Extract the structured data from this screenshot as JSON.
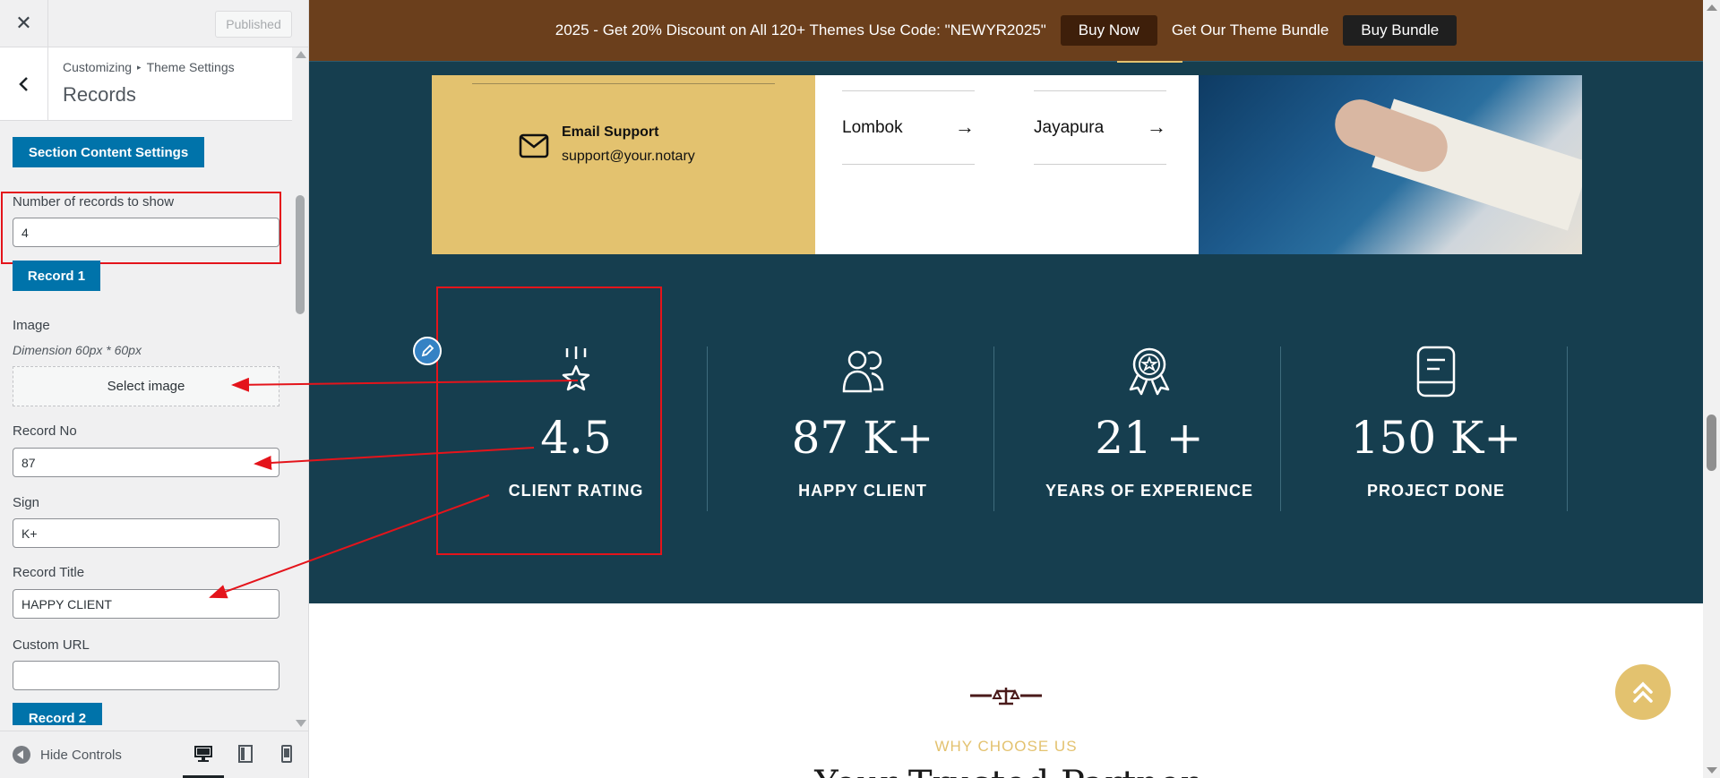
{
  "sidebar": {
    "close_icon": "close-icon",
    "published_label": "Published",
    "breadcrumb": {
      "parent": "Customizing",
      "child": "Theme Settings"
    },
    "title": "Records",
    "section_button": "Section Content Settings",
    "fields": {
      "num_records_label": "Number of records to show",
      "num_records_value": "4",
      "record1_button": "Record 1",
      "image_label": "Image",
      "image_desc": "Dimension 60px * 60px",
      "select_image": "Select image",
      "record_no_label": "Record No",
      "record_no_value": "87",
      "sign_label": "Sign",
      "sign_value": "K+",
      "record_title_label": "Record Title",
      "record_title_value": "HAPPY CLIENT",
      "custom_url_label": "Custom URL",
      "custom_url_value": "",
      "record2_button": "Record 2"
    },
    "footer": {
      "hide_controls": "Hide Controls"
    }
  },
  "preview": {
    "promo": {
      "text": "2025 - Get 20% Discount on All 120+ Themes Use Code: \"NEWYR2025\"",
      "buy_now": "Buy Now",
      "bundle_text": "Get Our Theme Bundle",
      "buy_bundle": "Buy Bundle"
    },
    "contact": {
      "email_title": "Email Support",
      "email_value": "support@your.notary",
      "cities": [
        "Lombok",
        "Jayapura"
      ]
    },
    "stats": [
      {
        "icon": "star-rating-icon",
        "number": "4.5",
        "title": "CLIENT RATING"
      },
      {
        "icon": "users-icon",
        "number": "87 K+",
        "title": "HAPPY CLIENT"
      },
      {
        "icon": "award-badge-icon",
        "number": "21 +",
        "title": "YEARS OF EXPERIENCE"
      },
      {
        "icon": "book-icon",
        "number": "150 K+",
        "title": "PROJECT DONE"
      }
    ],
    "why_label": "WHY CHOOSE US",
    "heading_peek": "Your Trusted Partner"
  },
  "colors": {
    "wp_blue": "#0073aa",
    "promo_bg": "#6b3f1c",
    "section_bg": "#163e4f",
    "gold": "#e3c26f",
    "annotation_red": "#e4141b"
  }
}
